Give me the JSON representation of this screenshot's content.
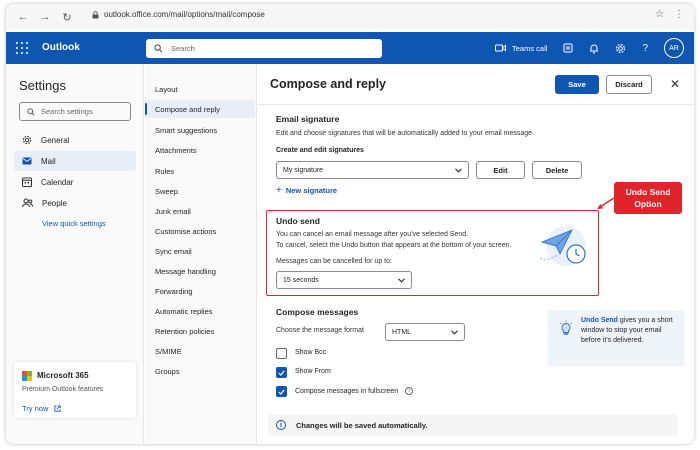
{
  "browser": {
    "url": "outlook.office.com/mail/options/mail/compose"
  },
  "header": {
    "app_name": "Outlook",
    "search_placeholder": "Search",
    "teams_call": "Teams call",
    "avatar_initials": "AR",
    "brand_color": "#0f56b3"
  },
  "settings": {
    "title": "Settings",
    "search_placeholder": "Search settings",
    "categories": [
      {
        "label": "General",
        "icon": "gear-icon"
      },
      {
        "label": "Mail",
        "icon": "mail-icon"
      },
      {
        "label": "Calendar",
        "icon": "calendar-icon"
      },
      {
        "label": "People",
        "icon": "people-icon"
      }
    ],
    "quick_link": "View quick settings",
    "m365": {
      "title": "Microsoft 365",
      "subtitle": "Premium Outlook features",
      "try_now": "Try now"
    }
  },
  "subnav": {
    "items": [
      "Layout",
      "Compose and reply",
      "Smart suggestions",
      "Attachments",
      "Rules",
      "Sweep",
      "Junk email",
      "Customise actions",
      "Sync email",
      "Message handling",
      "Forwarding",
      "Automatic replies",
      "Retention policies",
      "S/MIME",
      "Groups"
    ],
    "active_index": 1
  },
  "main": {
    "title": "Compose and reply",
    "save_label": "Save",
    "discard_label": "Discard",
    "signature": {
      "title": "Email signature",
      "description": "Edit and choose signatures that will be automatically added to your email message.",
      "subheading": "Create and edit signatures",
      "selected": "My signature",
      "edit_label": "Edit",
      "delete_label": "Delete",
      "new_label": "New signature"
    },
    "undo_send": {
      "title": "Undo send",
      "line1": "You can cancel an email message after you've selected Send.",
      "line2": "To cancel, select the Undo button that appears at the bottom of your screen.",
      "cancel_label": "Messages can be cancelled for up to:",
      "selected": "15 seconds"
    },
    "compose": {
      "title": "Compose messages",
      "format_label": "Choose the message format",
      "format_selected": "HTML",
      "options": [
        {
          "label": "Show Bcc",
          "checked": false
        },
        {
          "label": "Show From",
          "checked": true
        },
        {
          "label": "Compose messages in fullscreen",
          "checked": true
        }
      ]
    },
    "tip": {
      "bold": "Undo Send",
      "text": " gives you a short window to stop your email before it's delivered."
    },
    "footer": "Changes will be saved automatically."
  },
  "annotation": {
    "callout_line1": "Undo Send",
    "callout_line2": "Option",
    "color": "#e0242a"
  }
}
